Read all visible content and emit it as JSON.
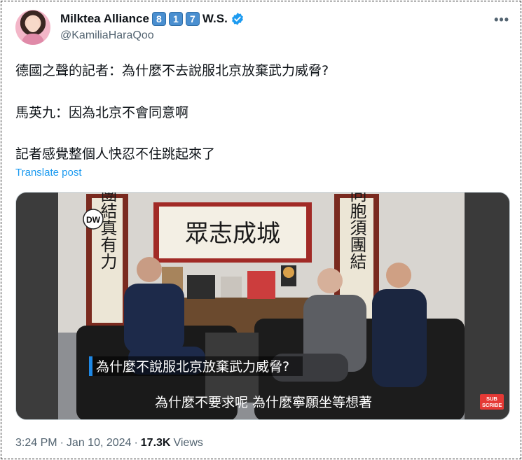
{
  "author": {
    "display_name": "Milktea Alliance",
    "keycaps": [
      "8",
      "1",
      "7"
    ],
    "name_suffix": "W.S.",
    "handle": "@KamiliaHaraQoo",
    "verified_icon": "verified-badge-icon",
    "avatar_icon": "avatar"
  },
  "post": {
    "line1": "德國之聲的記者：為什麼不去說服北京放棄武力威脅?",
    "line2": "馬英九：因為北京不會同意啊",
    "line3": "記者感覺整個人快忍不住跳起來了",
    "translate_label": "Translate post"
  },
  "video": {
    "logo_text": "DW",
    "calligraphy_top": "眾志成城",
    "calligraphy_left": "團結真有力",
    "calligraphy_right": "同胞須團結",
    "subtitle_question": "為什麼不說服北京放棄武力威脅?",
    "subtitle_answer": "為什麼不要求呢 為什麼寧願坐等想著",
    "subscribe_top": "SUB",
    "subscribe_bottom": "SCRIBE"
  },
  "meta": {
    "time": "3:24 PM",
    "sep1": "·",
    "date": "Jan 10, 2024",
    "sep2": "·",
    "views_count": "17.3K",
    "views_label": "Views"
  },
  "colors": {
    "link": "#1d9bf0",
    "secondary_text": "#536471",
    "keycap_blue": "#4a8fd0",
    "subscribe_red": "#e53935"
  }
}
